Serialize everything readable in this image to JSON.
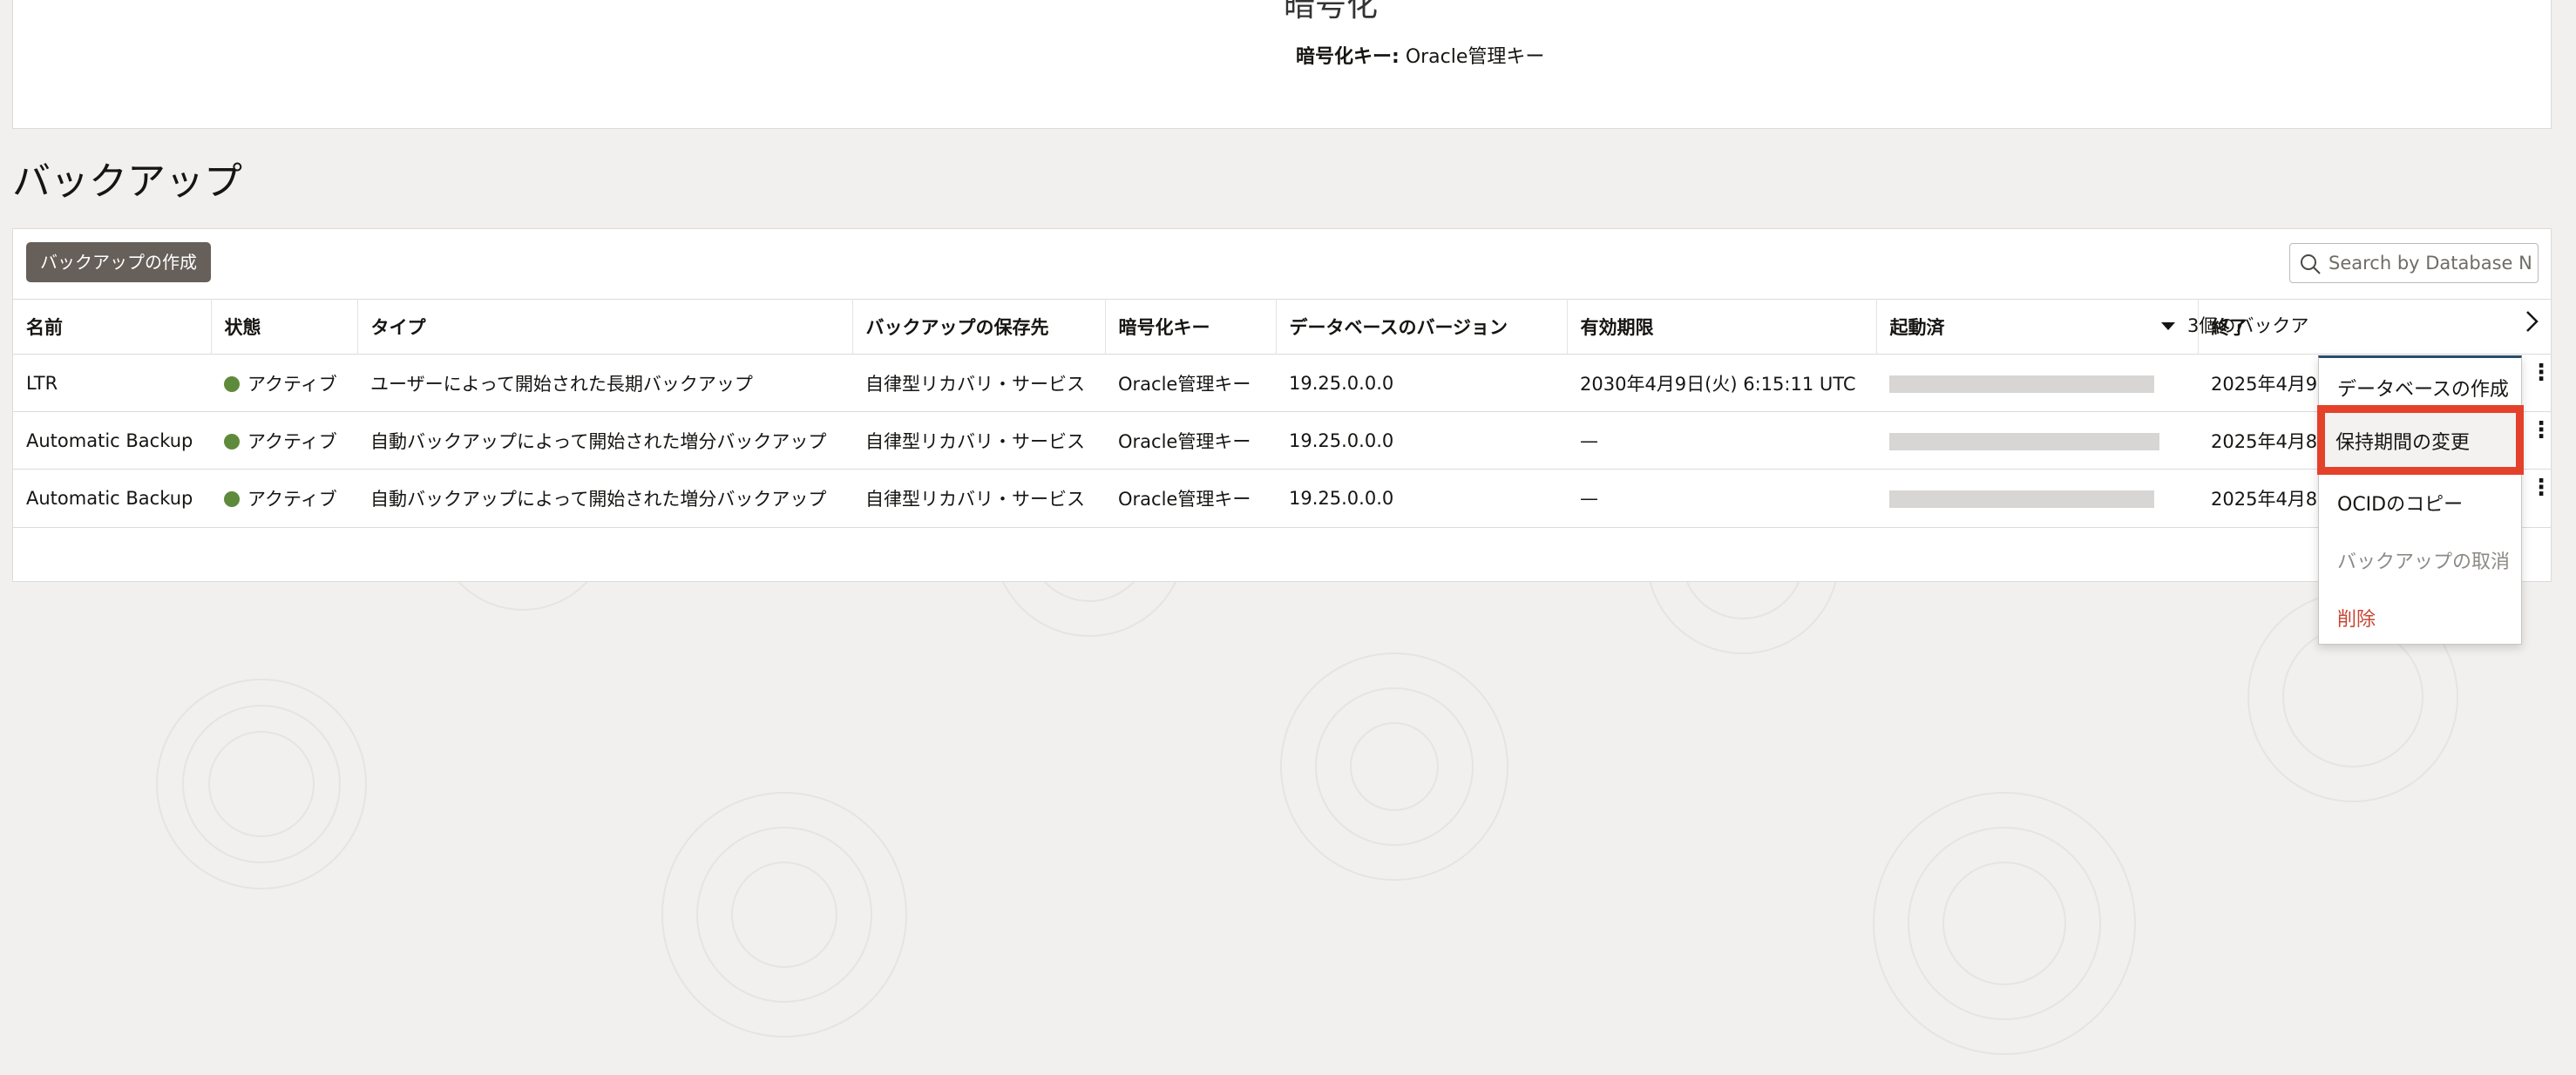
{
  "encryption": {
    "title": "暗号化",
    "key_label": "暗号化キー:",
    "key_value": "Oracle管理キー"
  },
  "section_title": "バックアップ",
  "toolbar": {
    "create_label": "バックアップの作成",
    "search_placeholder": "Search by Database N"
  },
  "table": {
    "headers": [
      "名前",
      "状態",
      "タイプ",
      "バックアップの保存先",
      "暗号化キー",
      "データベースのバージョン",
      "有効期限",
      "起動済",
      "終了"
    ],
    "sort_column": "起動済",
    "rows": [
      {
        "name": "LTR",
        "status": "アクティブ",
        "type": "ユーザーによって開始された長期バックアップ",
        "destination": "自律型リカバリ・サービス",
        "key": "Oracle管理キー",
        "version": "19.25.0.0.0",
        "expires": "2030年4月9日(火) 6:15:11 UTC",
        "started": "",
        "ended": "2025年4月9"
      },
      {
        "name": "Automatic Backup",
        "status": "アクティブ",
        "type": "自動バックアップによって開始された増分バックアップ",
        "destination": "自律型リカバリ・サービス",
        "key": "Oracle管理キー",
        "version": "19.25.0.0.0",
        "expires": "—",
        "started": "",
        "ended": "2025年4月8"
      },
      {
        "name": "Automatic Backup",
        "status": "アクティブ",
        "type": "自動バックアップによって開始された増分バックアップ",
        "destination": "自律型リカバリ・サービス",
        "key": "Oracle管理キー",
        "version": "19.25.0.0.0",
        "expires": "—",
        "started": "",
        "ended": "2025年4月8"
      }
    ]
  },
  "footer": {
    "count_text": "3個のバックア"
  },
  "context_menu": {
    "items": [
      {
        "label": "データベースの作成"
      },
      {
        "label": "保持期間の変更"
      },
      {
        "label": "OCIDのコピー"
      },
      {
        "label": "バックアップの取消"
      },
      {
        "label": "削除"
      }
    ],
    "highlighted": "保持期間の変更"
  },
  "colors": {
    "status_active": "#5e8a3b",
    "primary_button": "#665f5a",
    "highlight_border": "#e4412b",
    "danger_text": "#c74634"
  }
}
